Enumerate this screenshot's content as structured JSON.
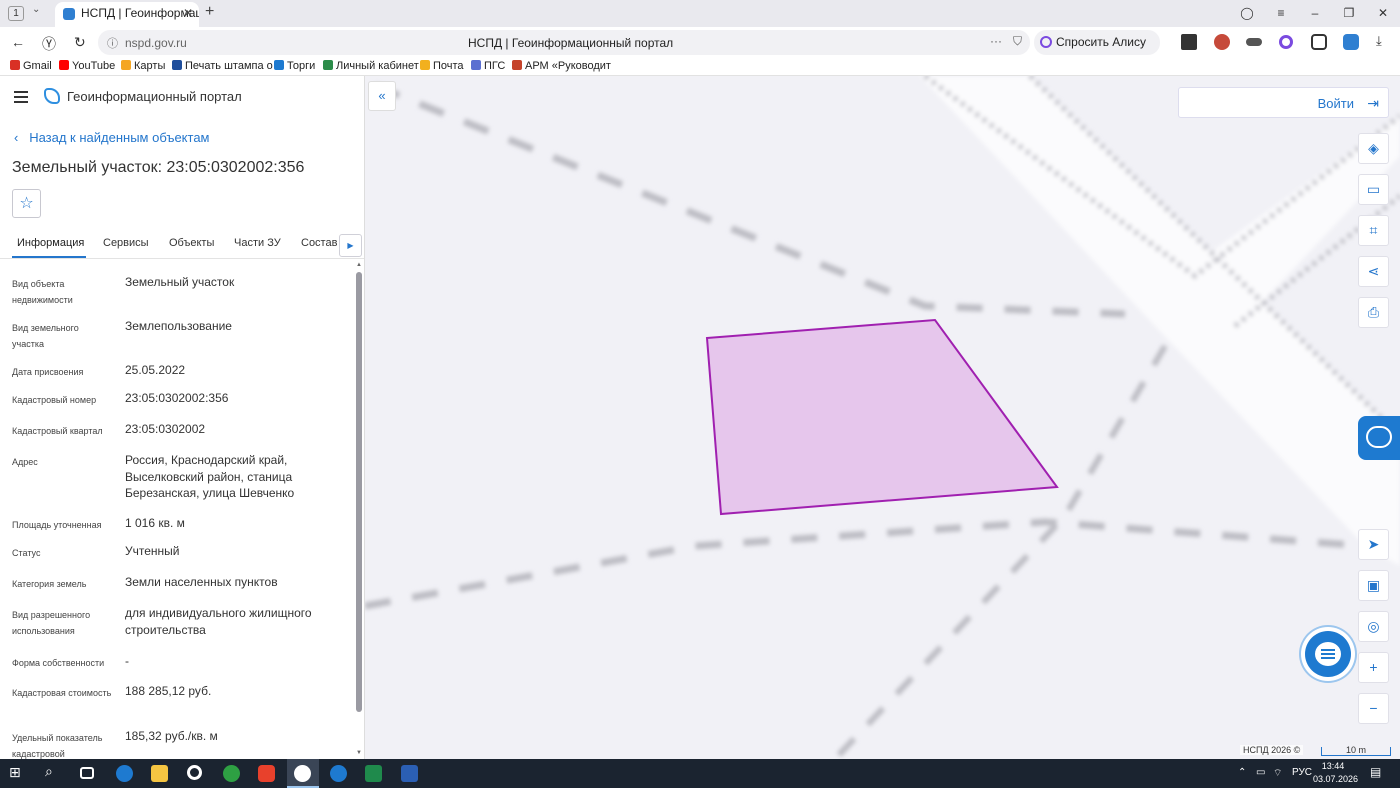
{
  "browser": {
    "tab_count": "1",
    "tab_title": "НСПД | Геоинформаци",
    "url": "nspd.gov.ru",
    "page_title": "НСПД | Геоинформационный портал",
    "alice_label": "Спросить Алису AI"
  },
  "bookmarks": [
    {
      "label": "Gmail",
      "color": "#d93025"
    },
    {
      "label": "YouTube",
      "color": "#ff0000"
    },
    {
      "label": "Карты",
      "color": "#f5a623"
    },
    {
      "label": "Печать штампа о",
      "color": "#1e4e9c"
    },
    {
      "label": "Торги",
      "color": "#1e7ad0"
    },
    {
      "label": "Личный кабинет",
      "color": "#2c8c4a"
    },
    {
      "label": "Почта",
      "color": "#f2b01e"
    },
    {
      "label": "ПГС",
      "color": "#5b6fd1"
    },
    {
      "label": "АРМ «Руководит",
      "color": "#c5432a"
    }
  ],
  "portal": {
    "name": "Геоинформационный портал",
    "back_label": "Назад к найденным объектам",
    "object_title": "Земельный участок: 23:05:0302002:356"
  },
  "tabs": [
    "Информация",
    "Сервисы",
    "Объекты",
    "Части ЗУ",
    "Состав"
  ],
  "properties": [
    {
      "label": "Вид объекта недвижимости",
      "value": "Земельный участок"
    },
    {
      "label": "Вид земельного участка",
      "value": "Землепользование"
    },
    {
      "label": "Дата присвоения",
      "value": "25.05.2022"
    },
    {
      "label": "Кадастровый номер",
      "value": "23:05:0302002:356"
    },
    {
      "label": "Кадастровый квартал",
      "value": "23:05:0302002"
    },
    {
      "label": "Адрес",
      "value": "Россия, Краснодарский край, Выселковский район, станица Березанская, улица Шевченко"
    },
    {
      "label": "Площадь уточненная",
      "value": "1 016 кв. м"
    },
    {
      "label": "Статус",
      "value": "Учтенный"
    },
    {
      "label": "Категория земель",
      "value": "Земли населенных пунктов"
    },
    {
      "label": "Вид разрешенного использования",
      "value": "для индивидуального жилищного строительства"
    },
    {
      "label": "Форма собственности",
      "value": "-"
    },
    {
      "label": "Кадастровая стоимость",
      "value": "188 285,12 руб."
    },
    {
      "label": "Удельный показатель кадастровой",
      "value": "185,32 руб./кв. м"
    }
  ],
  "map": {
    "login_label": "Войти",
    "attribution": "НСПД 2026 ©",
    "scale_label": "10 m",
    "parcel_fill": "#e6c6ec",
    "parcel_stroke": "#a020b0",
    "accent": "#2476cc"
  },
  "taskbar": {
    "language": "РУС",
    "time": "13:44",
    "date": "03.07.2026"
  }
}
